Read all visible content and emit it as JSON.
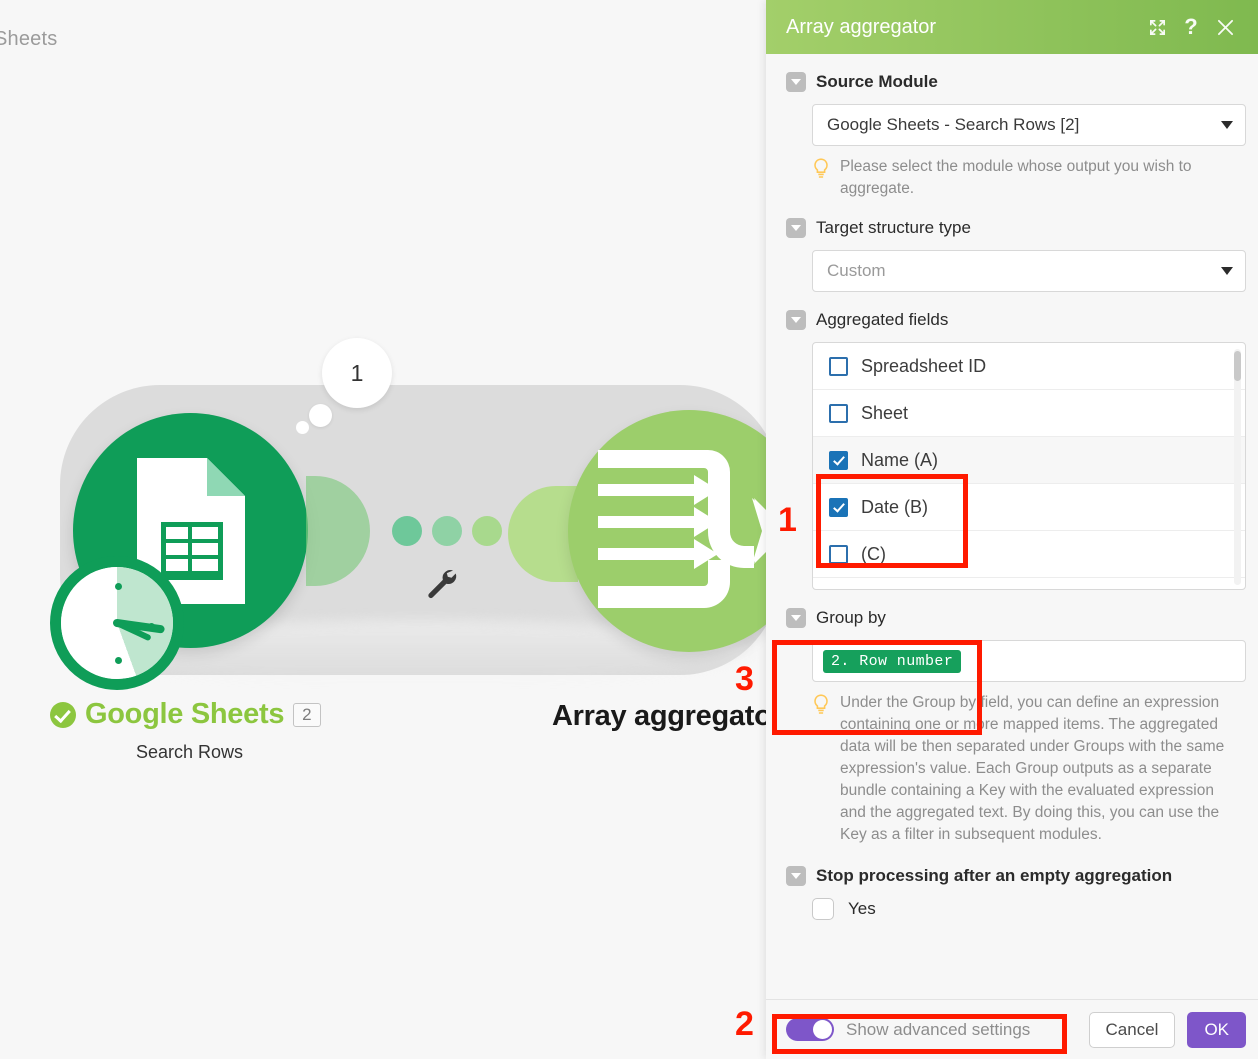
{
  "canvas": {
    "top_left_text": "Sheets",
    "bubble_count": "1",
    "sheets_module": {
      "name": "Google Sheets",
      "badge": "2",
      "action": "Search Rows",
      "status_icon": "check-circle-icon",
      "schedule_icon": "clock-icon"
    },
    "aggregator_module": {
      "name": "Array aggregator",
      "icon": "array-aggregator-icon"
    },
    "tool_icon": "wrench-icon"
  },
  "panel": {
    "title": "Array aggregator",
    "header_icons": {
      "expand": "expand-icon",
      "help": "help-icon",
      "close": "close-icon"
    },
    "sections": {
      "source_module": {
        "label": "Source Module",
        "value": "Google Sheets - Search Rows [2]",
        "hint": "Please select the module whose output you wish to aggregate."
      },
      "target_structure_type": {
        "label": "Target structure type",
        "value": "Custom"
      },
      "aggregated_fields": {
        "label": "Aggregated fields",
        "items": [
          {
            "label": "Spreadsheet ID",
            "checked": false
          },
          {
            "label": "Sheet",
            "checked": false
          },
          {
            "label": "Name (A)",
            "checked": true
          },
          {
            "label": "Date (B)",
            "checked": true
          },
          {
            "label": "(C)",
            "checked": false
          }
        ]
      },
      "group_by": {
        "label": "Group by",
        "token": "2. Row number",
        "hint": "Under the Group by field, you can define an expression containing one or more mapped items. The aggregated data will be then separated under Groups with the same expression's value. Each Group outputs as a separate bundle containing a Key with the evaluated expression and the aggregated text. By doing this, you can use the Key as a filter in subsequent modules."
      },
      "stop_processing": {
        "label": "Stop processing after an empty aggregation",
        "checkbox_label": "Yes",
        "checked": false
      }
    },
    "footer": {
      "advanced_toggle_label": "Show advanced settings",
      "advanced_toggle_on": true,
      "cancel_label": "Cancel",
      "ok_label": "OK"
    }
  },
  "annotations": {
    "one": "1",
    "two": "2",
    "three": "3",
    "color": "#ff1a00"
  },
  "colors": {
    "header_green_start": "#a3cf6a",
    "header_green_end": "#7fb94f",
    "sheets_green": "#0f9d58",
    "aggregator_green": "#9cce6b",
    "accent_purple": "#7e56c9",
    "checkbox_blue": "#1a73b7",
    "token_green": "#16a05c"
  }
}
